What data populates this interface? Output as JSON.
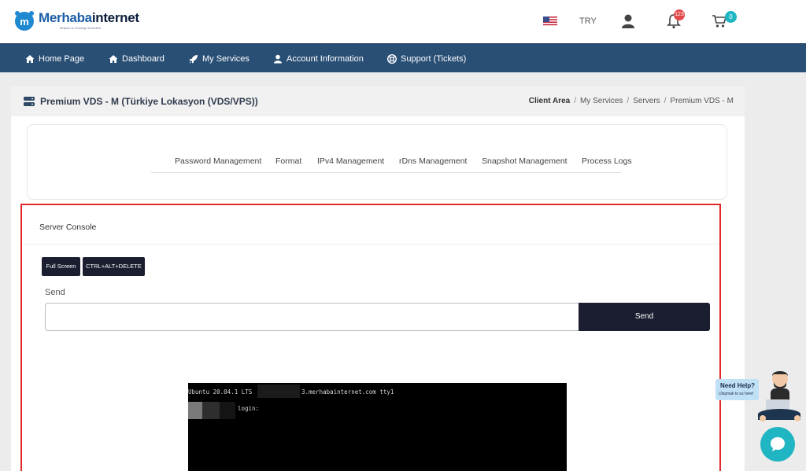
{
  "header": {
    "logo": {
      "name_part1": "Merhaba",
      "name_part2": "internet",
      "tagline": "Müşteri ve Hosting Hizmetleri",
      "accent_color": "#1e5ea8"
    },
    "currency": "TRY",
    "notifications_count": "123",
    "cart_count": "0",
    "icons": {
      "flag": "us-flag-icon",
      "user": "user-icon",
      "bell": "bell-icon",
      "cart": "cart-icon"
    }
  },
  "nav": {
    "items": [
      {
        "label": "Home Page",
        "icon": "home-icon"
      },
      {
        "label": "Dashboard",
        "icon": "home-icon"
      },
      {
        "label": "My Services",
        "icon": "rocket-icon"
      },
      {
        "label": "Account Information",
        "icon": "user-icon"
      },
      {
        "label": "Support (Tickets)",
        "icon": "lifebuoy-icon"
      }
    ],
    "color": "#294f75"
  },
  "page": {
    "title": "Premium VDS - M (Türkiye Lokasyon (VDS/VPS))",
    "breadcrumb": [
      "Client Area",
      "My Services",
      "Servers",
      "Premium VDS - M"
    ]
  },
  "tabs": [
    "Password Management",
    "Format",
    "IPv4 Management",
    "rDns Management",
    "Snapshot Management",
    "Process Logs"
  ],
  "console": {
    "title": "Server Console",
    "buttons": {
      "full_screen": "Full Screen",
      "ctrl_alt_delete": "CTRL+ALT+DELETE"
    },
    "send_label": "Send",
    "send_input_value": "",
    "send_button": "Send",
    "terminal_line1_prefix": "Ubuntu 20.04.1 LTS",
    "terminal_line1_suffix": "3.merhabainternet.com tty1",
    "terminal_line2": "login:",
    "highlight_color": "#e22a2a"
  },
  "help_widget": {
    "title": "Need Help?",
    "subtitle": "Ulaşmak to us here!"
  }
}
